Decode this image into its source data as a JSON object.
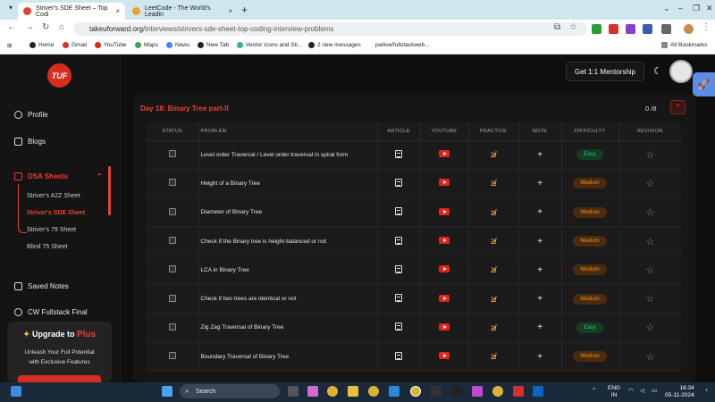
{
  "browser": {
    "tabs": [
      {
        "title": "Striver's SDE Sheet – Top Codi",
        "close": "×",
        "active": true,
        "color": "#e8412f"
      },
      {
        "title": "LeetCode - The World's Leadin",
        "close": "×",
        "active": false,
        "color": "#f0a030"
      }
    ],
    "new_tab": "+",
    "window_controls": [
      "⌄",
      "–",
      "❐",
      "✕"
    ],
    "url_host": "takeuforward.org",
    "url_path": "/interviews/strivers-sde-sheet-top-coding-interview-problems",
    "bookmarks": [
      "Home",
      "Gmail",
      "YouTube",
      "Maps",
      "News",
      "New Tab",
      "Vector Icons and Sti...",
      "2 new messages",
      "pwlive/fullstackweb..."
    ],
    "all_bookmarks": "All Bookmarks"
  },
  "sidebar": {
    "logo": "TUF",
    "items": [
      {
        "label": "Profile",
        "icon": "profile-icon"
      },
      {
        "label": "Blogs",
        "icon": "blog-icon"
      },
      {
        "label": "DSA Sheets",
        "icon": "sheet-icon",
        "active": true
      },
      {
        "label": "Saved Notes",
        "icon": "bookmark-icon"
      },
      {
        "label": "CW Fullstack Final",
        "icon": "link-icon"
      }
    ],
    "sheets": [
      "Striver's A2Z Sheet",
      "Striver's SDE Sheet",
      "Striver's 79 Sheet",
      "Blind 75 Sheet"
    ],
    "active_sheet": "Striver's SDE Sheet",
    "upgrade": {
      "title": "Upgrade to ",
      "plus": "Plus",
      "desc1": "Unleash Your Full Potential",
      "desc2": "with Exclusive Features"
    }
  },
  "header": {
    "mentorship": "Get 1:1 Mentorship"
  },
  "section": {
    "title": "Day 18: Binary Tree part-II",
    "count": "0 /8"
  },
  "table": {
    "headers": [
      "STATUS",
      "PROBLEM",
      "ARTICLE",
      "YOUTUBE",
      "PRACTICE",
      "NOTE",
      "DIFFICULTY",
      "REVISION"
    ],
    "rows": [
      {
        "problem": "Level order Traversal / Level order traversal in spiral form",
        "difficulty": "Easy"
      },
      {
        "problem": "Height of a Binary Tree",
        "difficulty": "Medium"
      },
      {
        "problem": "Diameter of Binary Tree",
        "difficulty": "Medium"
      },
      {
        "problem": "Check if the Binary tree is height-balanced or not",
        "difficulty": "Medium"
      },
      {
        "problem": "LCA in Binary Tree",
        "difficulty": "Medium"
      },
      {
        "problem": "Check if two trees are identical or not",
        "difficulty": "Medium"
      },
      {
        "problem": "Zig Zag Traversal of Binary Tree",
        "difficulty": "Easy"
      },
      {
        "problem": "Boundary Traversal of Binary Tree",
        "difficulty": "Medium"
      }
    ]
  },
  "taskbar": {
    "search": "Search",
    "lang1": "ENG",
    "lang2": "IN",
    "time": "16:34",
    "date": "05-11-2024"
  }
}
